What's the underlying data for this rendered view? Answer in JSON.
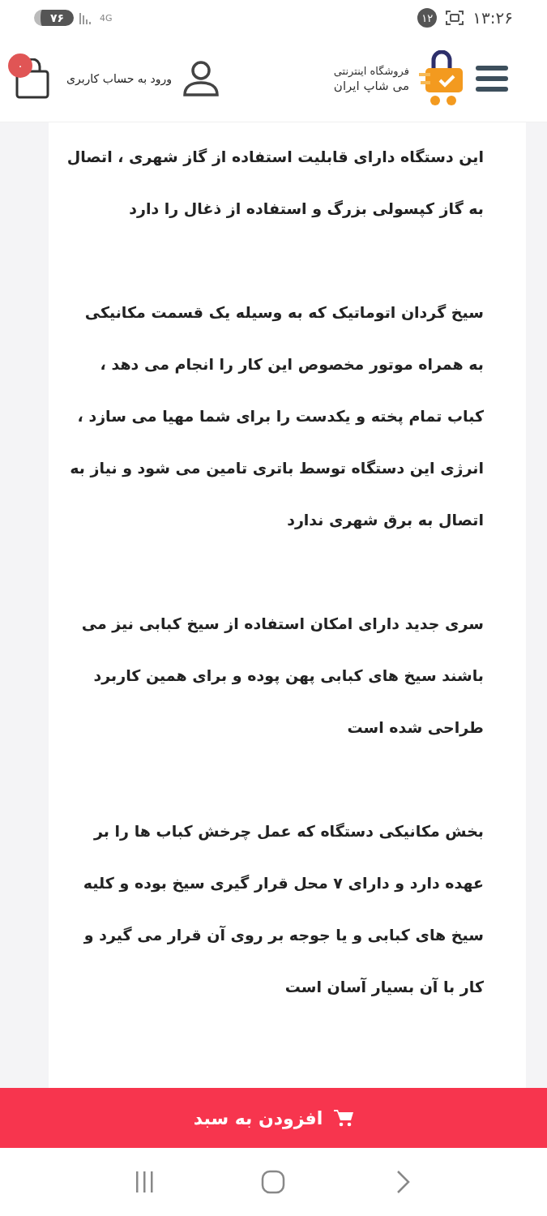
{
  "status_bar": {
    "time": "۱۳:۲۶",
    "notification_count": "۱۲",
    "network": "4G",
    "battery": "۷۶"
  },
  "header": {
    "store_line_1": "فروشگاه اینترنتی",
    "store_line_2": "می شاپ ایران",
    "login": "ورود به حساب کاربری",
    "cart_count": "۰"
  },
  "paragraphs": [
    "این دستگاه دارای قابلیت استفاده از گاز شهری ، اتصال به گاز کپسولی بزرگ و استفاده از ذغال را دارد",
    "سیخ گردان اتوماتیک که به وسیله یک قسمت مکانیکی به همراه موتور مخصوص این کار را انجام می دهد ، کباب تمام پخته و یکدست را برای شما مهیا می سازد ، انرژی این دستگاه توسط باتری تامین می شود و نیاز به اتصال به برق شهری ندارد",
    "سری جدید دارای امکان استفاده از سیخ کبابی نیز می باشند سیخ های کبابی پهن پوده و برای همین کاربرد طراحی شده است",
    "بخش مکانیکی دستگاه که عمل چرخش کباب ها را بر عهده دارد و دارای ۷ محل قرار گیری سیخ بوده و کلیه سیخ های کبابی و یا جوجه بر روی آن قرار می گیرد و کار با آن بسیار آسان است"
  ],
  "add_to_cart": "افزودن به سبد"
}
